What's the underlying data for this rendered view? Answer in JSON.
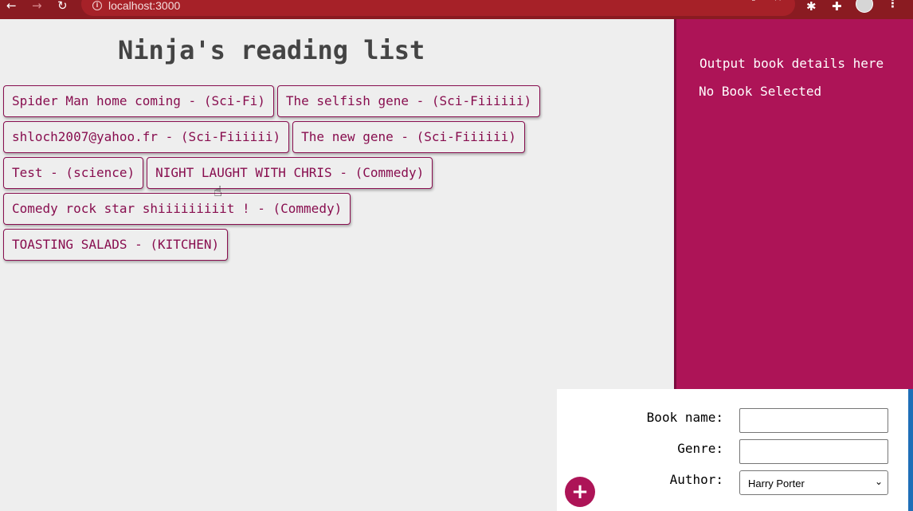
{
  "browser": {
    "url": "localhost:3000",
    "back_icon": "←",
    "forward_icon": "→",
    "reload_icon": "↻",
    "info_icon": "i",
    "share_icon": "⇪",
    "bookmark_icon": "☆",
    "extension_icon": "✱",
    "puzzle_icon": "✚",
    "menu_icon": "⋮"
  },
  "page": {
    "title": "Ninja's reading list"
  },
  "books": [
    {
      "label": "Spider Man home coming - (Sci-Fi)"
    },
    {
      "label": "The selfish gene - (Sci-Fiiiiii)"
    },
    {
      "label": "shloch2007@yahoo.fr - (Sci-Fiiiiii)"
    },
    {
      "label": "The new gene - (Sci-Fiiiiii)"
    },
    {
      "label": "Test - (science)"
    },
    {
      "label": "NIGHT LAUGHT WITH CHRIS - (Commedy)"
    },
    {
      "label": "Comedy rock star shiiiiiiiiit ! - (Commedy)"
    },
    {
      "label": "TOASTING SALADS - (KITCHEN)"
    }
  ],
  "details": {
    "heading": "Output book details here",
    "empty_text": "No Book Selected"
  },
  "form": {
    "name_label": "Book name:",
    "name_value": "",
    "genre_label": "Genre:",
    "genre_value": "",
    "author_label": "Author:",
    "author_selected": "Harry Porter",
    "add_icon": "+"
  },
  "colors": {
    "accent": "#ad1457",
    "book_text": "#880e4f",
    "chrome": "#8a1b21"
  }
}
